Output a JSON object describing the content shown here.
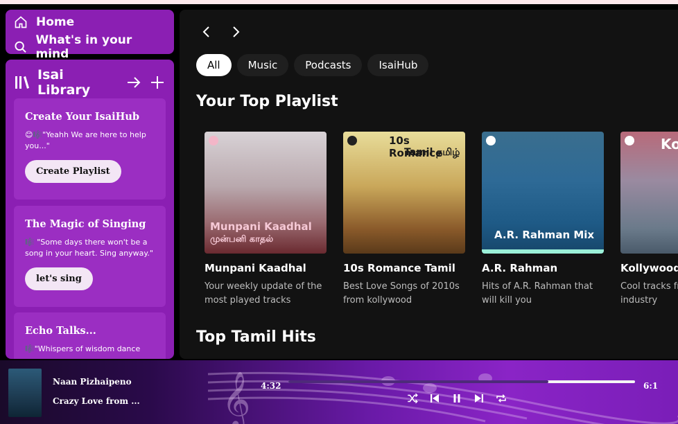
{
  "nav": {
    "home": "Home",
    "search": "What's in your mind"
  },
  "library": {
    "title": "Isai Library",
    "cards": [
      {
        "title": "Create Your IsaiHub",
        "text": "😊🎼\"Yeahh We are here to help you...\"",
        "button": "Create Playlist"
      },
      {
        "title": "The Magic of Singing",
        "text": "🎼 \"Some days there won't be a song in your heart. Sing anyway.\"",
        "button": "let's sing"
      },
      {
        "title": "Echo Talks...",
        "text": "🎼\"Whispers of wisdom dance",
        "button": ""
      }
    ]
  },
  "chips": [
    "All",
    "Music",
    "Podcasts",
    "IsaiHub"
  ],
  "sections": {
    "top_playlist": "Your Top Playlist",
    "top_tamil": "Top Tamil Hits"
  },
  "playlists": [
    {
      "cover_text": "Munpani Kaadhal",
      "cover_sub": "முன்பனி காதல்",
      "name": "Munpani Kaadhal",
      "desc": "Your weekly update of the most played tracks"
    },
    {
      "cover_text": "10s Romance",
      "cover_sub": "Tamil தமிழ்",
      "name": "10s Romance Tamil",
      "desc": "Best Love Songs of 2010s from kollywood"
    },
    {
      "cover_text": "A.R. Rahman Mix",
      "cover_sub": "",
      "name": "A.R. Rahman",
      "desc": "Hits of A.R. Rahman that will kill you"
    },
    {
      "cover_text": "Kol",
      "cover_sub": "",
      "name": "Kollywood",
      "desc": "Cool tracks from the music industry"
    }
  ],
  "player": {
    "song": "Naan Pizhaipeno",
    "artist": "Crazy Love from ...",
    "elapsed": "4:32",
    "total": "6:1",
    "progress": 0.75
  },
  "colors": {
    "sidebar": "#8b1fb3",
    "card": "#9b2ec2",
    "main": "#121212"
  }
}
